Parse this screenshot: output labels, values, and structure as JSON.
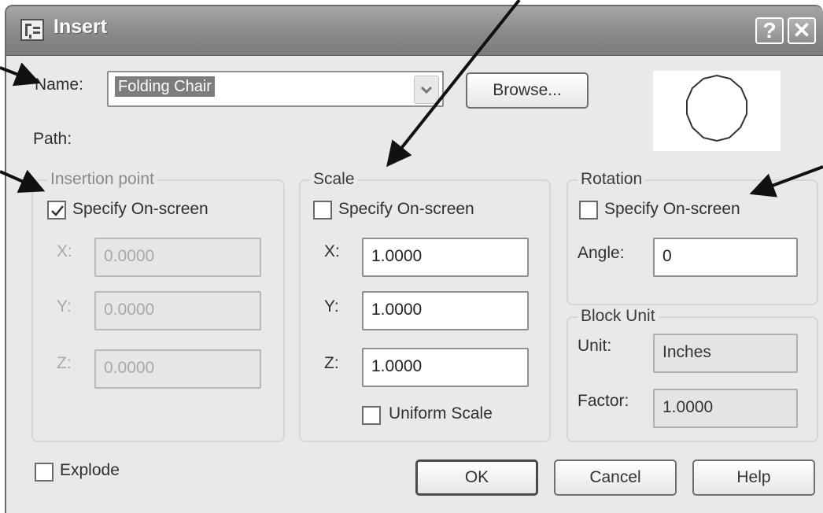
{
  "window": {
    "title": "Insert",
    "icon": "autocad-app-icon",
    "help_glyph": "?",
    "close_glyph": "✕"
  },
  "name_row": {
    "label": "Name:",
    "value": "Folding Chair",
    "browse_label": "Browse..."
  },
  "path_label": "Path:",
  "insertion_point": {
    "title": "Insertion point",
    "specify_label": "Specify On-screen",
    "specify_checked": true,
    "x_label": "X:",
    "x_value": "0.0000",
    "y_label": "Y:",
    "y_value": "0.0000",
    "z_label": "Z:",
    "z_value": "0.0000"
  },
  "scale": {
    "title": "Scale",
    "specify_label": "Specify On-screen",
    "specify_checked": false,
    "x_label": "X:",
    "x_value": "1.0000",
    "y_label": "Y:",
    "y_value": "1.0000",
    "z_label": "Z:",
    "z_value": "1.0000",
    "uniform_label": "Uniform Scale",
    "uniform_checked": false
  },
  "rotation": {
    "title": "Rotation",
    "specify_label": "Specify On-screen",
    "specify_checked": false,
    "angle_label": "Angle:",
    "angle_value": "0"
  },
  "block_unit": {
    "title": "Block Unit",
    "unit_label": "Unit:",
    "unit_value": "Inches",
    "factor_label": "Factor:",
    "factor_value": "1.0000"
  },
  "explode": {
    "label": "Explode",
    "checked": false
  },
  "buttons": {
    "ok": "OK",
    "cancel": "Cancel",
    "help": "Help"
  }
}
